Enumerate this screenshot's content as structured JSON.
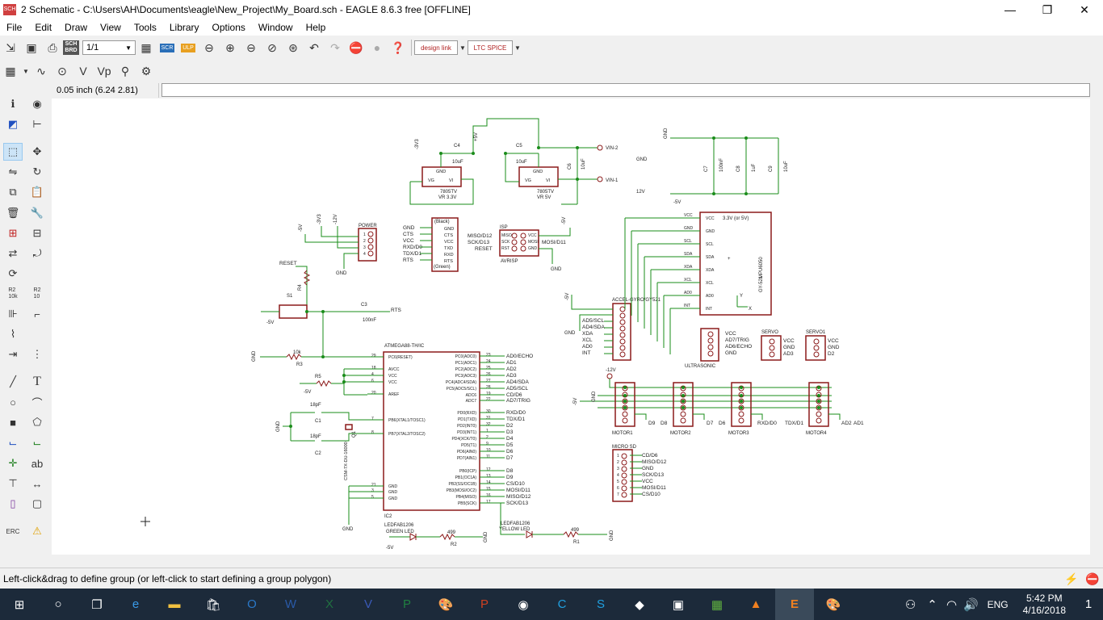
{
  "window": {
    "title": "2 Schematic - C:\\Users\\AH\\Documents\\eagle\\New_Project\\My_Board.sch - EAGLE 8.6.3 free [OFFLINE]",
    "app_icon": "SCH",
    "minimize": "—",
    "restore": "❐",
    "close": "✕"
  },
  "menu": [
    "File",
    "Edit",
    "Draw",
    "View",
    "Tools",
    "Library",
    "Options",
    "Window",
    "Help"
  ],
  "toolbar": {
    "sheet_select": "1/1",
    "sch_brd": "SCH BRD",
    "scr": "SCR",
    "ulp": "ULP",
    "design_link": "design link",
    "ltc_spice": "LTC SPICE"
  },
  "coords": "0.05 inch (6.24 2.81)",
  "command_value": "",
  "status": "Left-click&drag to define group (or left-click to start defining a group polygon)",
  "left_labels": {
    "r2a": "R2\n10k",
    "r2b": "R2\n10"
  },
  "left_text_tool": "T",
  "taskbar": {
    "lang": "ENG",
    "time": "5:42 PM",
    "date": "4/16/2018",
    "notif": "1"
  },
  "schematic": {
    "reg1": {
      "name": "7805TV",
      "value": "VR 3.3V",
      "pins": [
        "GND",
        "VG",
        "VI"
      ]
    },
    "reg2": {
      "name": "7805TV",
      "value": "VR 5V",
      "pins": [
        "GND",
        "VG",
        "VI"
      ]
    },
    "caps_top": [
      "C4",
      "10uF",
      "C5",
      "10uF",
      "C6",
      "10uF"
    ],
    "vin": [
      "VIN-2",
      "VIN-1"
    ],
    "rails": [
      "GND",
      "-12V",
      "-5V",
      "-3V3",
      "+5V",
      "12V"
    ],
    "caps_right": [
      "C7",
      "100nF",
      "C8",
      "1uF",
      "C9",
      "10uF"
    ],
    "power": {
      "name": "POWER",
      "pins": [
        "1",
        "2",
        "3",
        "4"
      ],
      "nets": [
        "-5V",
        "-3V3",
        "-12V",
        "GND"
      ]
    },
    "ftdi": {
      "header": "(Black)",
      "footer": "(Green)",
      "left": [
        "GND",
        "CTS",
        "VCC",
        "RXD/D0",
        "TDX/D1",
        "RTS"
      ],
      "right": [
        "GND",
        "CTS",
        "VCC",
        "TXD",
        "RXD",
        "RTS"
      ]
    },
    "isp": {
      "name": "ISP",
      "pins": [
        "MISO",
        "SCK",
        "RST",
        "VCC",
        "MOSI",
        "GND"
      ],
      "left": [
        "MISO/D12",
        "SCK/D13",
        "RESET"
      ],
      "right": "MOSI/D11",
      "label": "AVRISP"
    },
    "gy521": {
      "pins": [
        "VCC",
        "GND",
        "SCL",
        "SDA",
        "XDA",
        "XCL",
        "AD0",
        "INT"
      ],
      "title": "3.3V (or 5V)",
      "name": "GY-521",
      "chip": "MPU6050",
      "axis_y": "Y",
      "axis_x": "X"
    },
    "accel_hdr": {
      "name": "ACCEL-GYRO/GY521",
      "nets": [
        "AD5/SCL",
        "AD4/SDA",
        "XDA",
        "XCL",
        "AD0",
        "INT"
      ]
    },
    "ultra": {
      "name": "ULTRASONIC",
      "nets": [
        "VCC",
        "AD7/TRIG",
        "AD6/ECHO",
        "GND"
      ]
    },
    "servo": {
      "names": [
        "SERVO",
        "SERVO1"
      ],
      "nets1": [
        "VCC",
        "GND",
        "AD3"
      ],
      "nets2": [
        "VCC",
        "GND",
        "D2"
      ]
    },
    "reset": {
      "net": "RESET",
      "r4": "R4",
      "r3": "R3",
      "r3v": "10k",
      "s1": "S1"
    },
    "c3": {
      "name": "C3",
      "value": "100nF",
      "net": "RTS"
    },
    "r5": "R5",
    "mcu": {
      "name": "ATMEGA88-TH/IC",
      "ref": "IC2",
      "left": [
        "PC6(RESET)",
        "AVCC",
        "VCC",
        "VCC",
        "AREF",
        "PB6(XTAL1/TOSC1)",
        "PB7(XTAL2/TOSC2)",
        "GND",
        "GND",
        "GND"
      ],
      "left_nums": [
        "29",
        "18",
        "4",
        "6",
        "20",
        "7",
        "8",
        "21",
        "3",
        "5"
      ],
      "right": [
        "PC0(ADC0)",
        "PC1(ADC1)",
        "PC2(ADC2)",
        "PC3(ADC3)",
        "PC4(ADC4/SDA)",
        "PC5(ADC5/SCL)",
        "ADC6",
        "ADC7",
        "PD0(RXD)",
        "PD1(TXD)",
        "PD2(INT0)",
        "PD3(INT1)",
        "PD4(XCK/T0)",
        "PD5(T1)",
        "PD6(AIN0)",
        "PD7(AIN1)",
        "PB0(ICP)",
        "PB1(OC1A)",
        "PB2(SS/OC1B)",
        "PB3(MOSI/OC2)",
        "PB4(MISO)",
        "PB5(SCK)"
      ],
      "right_nums": [
        "23",
        "24",
        "25",
        "26",
        "27",
        "28",
        "19",
        "22",
        "30",
        "31",
        "32",
        "1",
        "2",
        "9",
        "10",
        "11",
        "12",
        "13",
        "14",
        "15",
        "16",
        "17"
      ],
      "right_nets": [
        "AD0/ECHO",
        "AD1",
        "AD2",
        "AD3",
        "AD4/SDA",
        "AD5/SCL",
        "CD/D6",
        "AD7/TRIG",
        "RXD/D0",
        "TDX/D1",
        "D2",
        "D3",
        "D4",
        "D5",
        "D6",
        "D7",
        "D8",
        "D9",
        "CS/D10",
        "MOSI/D11",
        "MISO/D12",
        "SCK/D13"
      ]
    },
    "xtal": {
      "c1": "C1",
      "c2": "C2",
      "cv": "18pF",
      "q": "Q1",
      "part": "CSM-7X-DU-16000"
    },
    "leds": {
      "g1": "LEDFAB1206",
      "g2": "GREEN LED",
      "y1": "LEDFAB1206",
      "y2": "YELLOW LED",
      "r2": "R2",
      "r1": "R1",
      "rv": "499"
    },
    "motors": {
      "names": [
        "MOTOR1",
        "MOTOR2",
        "MOTOR3",
        "MOTOR4"
      ],
      "nets": [
        "D9",
        "D8",
        "D7",
        "D6",
        "RXD/D0",
        "TDX/D1",
        "AD2",
        "AD1"
      ]
    },
    "microsd": {
      "name": "MICRO SD",
      "nets": [
        "CD/D6",
        "MISO/D12",
        "GND",
        "SCK/D13",
        "VCC",
        "MOSI/D11",
        "CS/D10"
      ]
    }
  }
}
